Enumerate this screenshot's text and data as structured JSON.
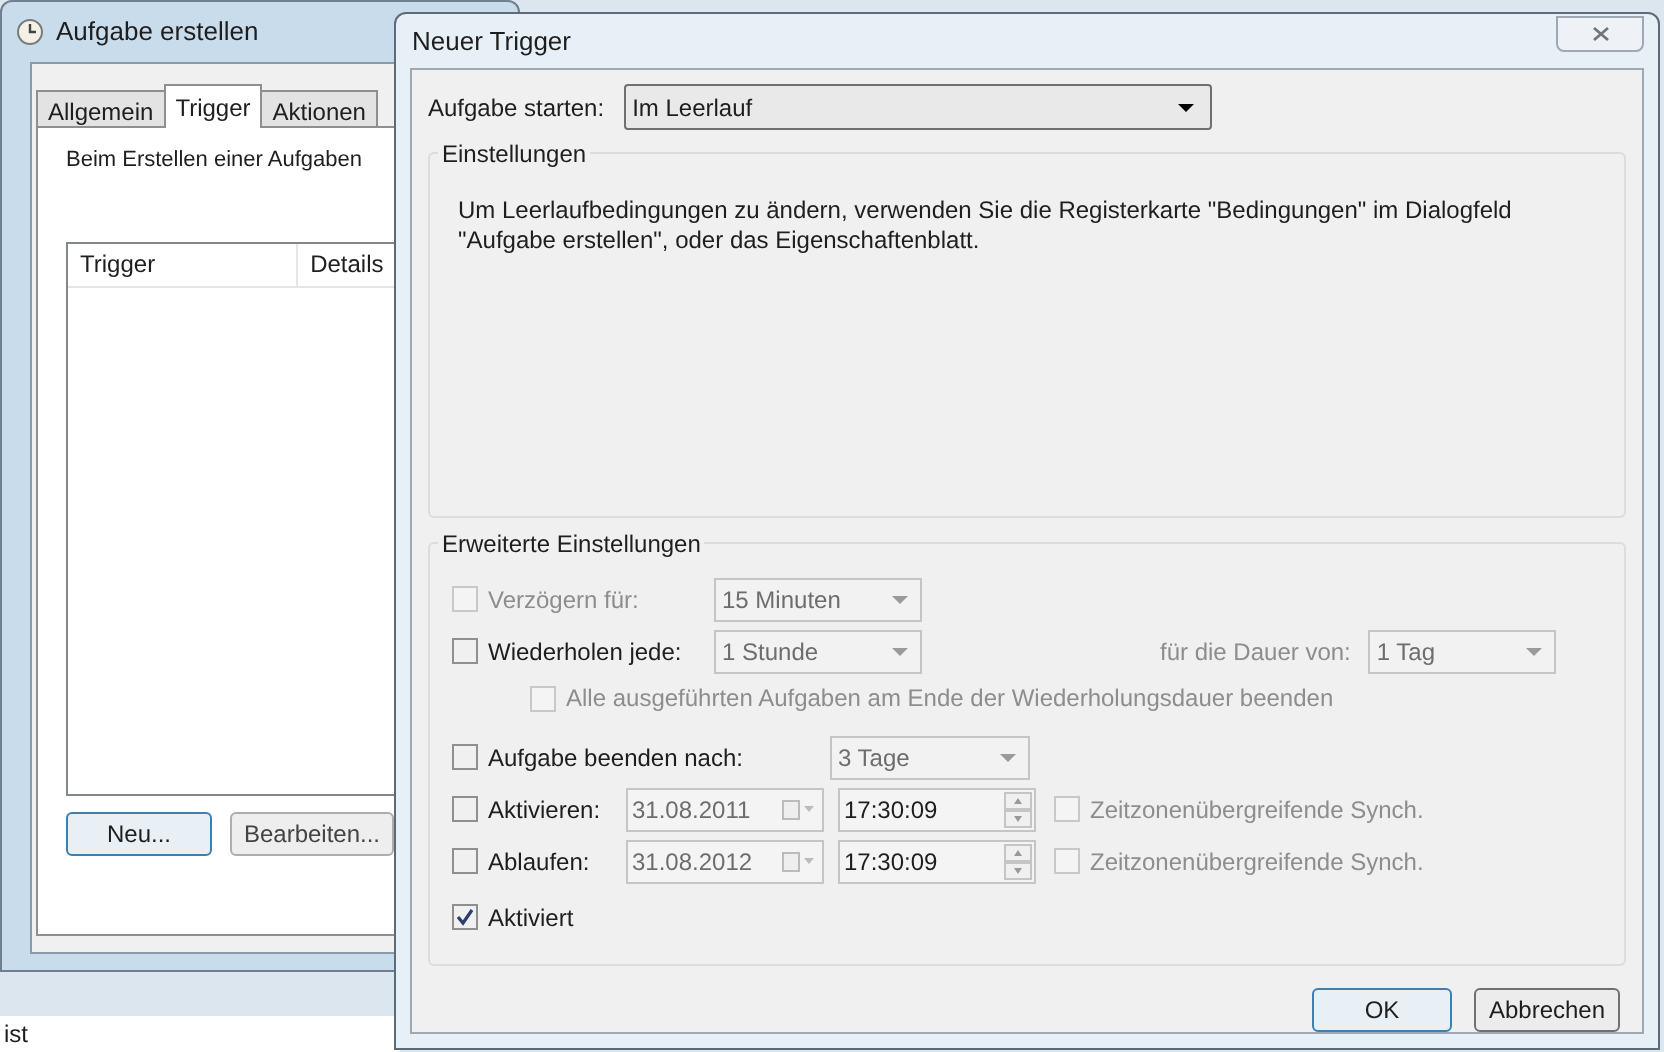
{
  "back_window": {
    "title": "Aufgabe erstellen",
    "tabs": [
      {
        "label": "Allgemein",
        "selected": false
      },
      {
        "label": "Trigger",
        "selected": true
      },
      {
        "label": "Aktionen",
        "selected": false
      }
    ],
    "intro": "Beim Erstellen einer Aufgaben",
    "table": {
      "columns": [
        "Trigger",
        "Details"
      ]
    },
    "buttons": [
      {
        "label": "Neu...",
        "default": true
      },
      {
        "label": "Bearbeiten...",
        "default": false
      }
    ]
  },
  "background_text": "ist",
  "dialog": {
    "title": "Neuer Trigger",
    "start": {
      "label": "Aufgabe starten:",
      "value": "Im Leerlauf"
    },
    "settings": {
      "title": "Einstellungen",
      "text": "Um Leerlaufbedingungen zu ändern, verwenden Sie die Registerkarte \"Bedingungen\" im Dialogfeld \"Aufgabe erstellen\", oder das Eigenschaftenblatt."
    },
    "advanced": {
      "title": "Erweiterte Einstellungen",
      "rows": [
        {
          "kind": "select",
          "label": "Verzögern für:",
          "checked": false,
          "disabled": true,
          "value": "15 Minuten"
        },
        {
          "kind": "select",
          "label": "Wiederholen jede:",
          "checked": false,
          "disabled": false,
          "value": "1 Stunde",
          "duration": {
            "label": "für die Dauer von:",
            "value": "1 Tag"
          }
        },
        {
          "kind": "sub",
          "label": "Alle ausgeführten Aufgaben am Ende der Wiederholungsdauer beenden",
          "checked": false,
          "disabled": true
        },
        {
          "kind": "select",
          "label": "Aufgabe beenden nach:",
          "checked": false,
          "disabled": false,
          "value": "3 Tage"
        },
        {
          "kind": "datetime",
          "label": "Aktivieren:",
          "checked": false,
          "disabled": false,
          "date": "31.08.2011",
          "time": "17:30:09",
          "sync": {
            "label": "Zeitzonenübergreifende Synch.",
            "checked": false
          }
        },
        {
          "kind": "datetime",
          "label": "Ablaufen:",
          "checked": false,
          "disabled": false,
          "date": "31.08.2012",
          "time": "17:30:09",
          "sync": {
            "label": "Zeitzonenübergreifende Synch.",
            "checked": false
          }
        },
        {
          "kind": "check",
          "label": "Aktiviert",
          "checked": true,
          "disabled": false
        }
      ]
    },
    "buttons": [
      {
        "label": "OK",
        "default": true
      },
      {
        "label": "Abbrechen",
        "default": false
      }
    ]
  }
}
